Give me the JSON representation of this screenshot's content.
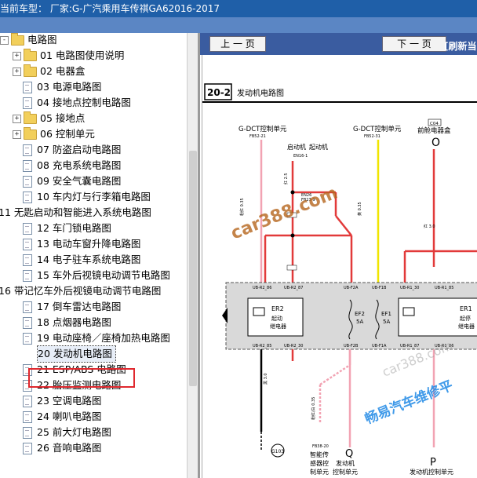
{
  "titlebar": {
    "text": "当前车型：  厂家:G-广汽乘用车传祺GA62016-2017"
  },
  "tree": {
    "items": [
      {
        "label": "电路图",
        "level": 0,
        "expander": "-",
        "icon": "folder"
      },
      {
        "label": "01 电路图使用说明",
        "level": 1,
        "expander": "+",
        "icon": "folder"
      },
      {
        "label": "02 电器盒",
        "level": 1,
        "expander": "+",
        "icon": "folder"
      },
      {
        "label": "03 电源电路图",
        "level": 1,
        "expander": "",
        "icon": "doc"
      },
      {
        "label": "04 接地点控制电路图",
        "level": 1,
        "expander": "",
        "icon": "doc"
      },
      {
        "label": "05 接地点",
        "level": 1,
        "expander": "+",
        "icon": "folder"
      },
      {
        "label": "06 控制单元",
        "level": 1,
        "expander": "+",
        "icon": "folder"
      },
      {
        "label": "07 防盗启动电路图",
        "level": 1,
        "expander": "",
        "icon": "doc"
      },
      {
        "label": "08 充电系统电路图",
        "level": 1,
        "expander": "",
        "icon": "doc"
      },
      {
        "label": "09 安全气囊电路图",
        "level": 1,
        "expander": "",
        "icon": "doc"
      },
      {
        "label": "10 车内灯与行李箱电路图",
        "level": 1,
        "expander": "",
        "icon": "doc"
      },
      {
        "label": "11 无匙启动和智能进入系统电路图",
        "level": -1,
        "expander": "",
        "icon": "none"
      },
      {
        "label": "12 车门锁电路图",
        "level": 1,
        "expander": "",
        "icon": "doc"
      },
      {
        "label": "13 电动车窗升降电路图",
        "level": 1,
        "expander": "",
        "icon": "doc"
      },
      {
        "label": "14 电子驻车系统电路图",
        "level": 1,
        "expander": "",
        "icon": "doc"
      },
      {
        "label": "15 车外后视镜电动调节电路图",
        "level": 1,
        "expander": "",
        "icon": "doc"
      },
      {
        "label": "16 带记忆车外后视镜电动调节电路图",
        "level": -1,
        "expander": "",
        "icon": "none"
      },
      {
        "label": "17 倒车雷达电路图",
        "level": 1,
        "expander": "",
        "icon": "doc"
      },
      {
        "label": "18 点烟器电路图",
        "level": 1,
        "expander": "",
        "icon": "doc"
      },
      {
        "label": "19 电动座椅／座椅加热电路图",
        "level": 1,
        "expander": "",
        "icon": "doc"
      },
      {
        "label": "20 发动机电路图",
        "level": 1,
        "expander": "",
        "icon": "doc",
        "selected": true
      },
      {
        "label": "21 ESP/ABS 电路图",
        "level": 1,
        "expander": "",
        "icon": "doc"
      },
      {
        "label": "22 胎压监测电路图",
        "level": 1,
        "expander": "",
        "icon": "doc"
      },
      {
        "label": "23 空调电路图",
        "level": 1,
        "expander": "",
        "icon": "doc"
      },
      {
        "label": "24 喇叭电路图",
        "level": 1,
        "expander": "",
        "icon": "doc"
      },
      {
        "label": "25 前大灯电路图",
        "level": 1,
        "expander": "",
        "icon": "doc"
      },
      {
        "label": "26 音响电路图",
        "level": 1,
        "expander": "",
        "icon": "doc"
      }
    ]
  },
  "viewer": {
    "prev": "上 一 页",
    "next": "下 一 页",
    "refresh": "[刷新当",
    "diagram": {
      "section_no": "20-2",
      "section_title": "发动机电路图",
      "label_dct1": "G-DCT控制单元",
      "label_dct1_pin": "FB52-21",
      "label_dct2": "G-DCT控制单元",
      "label_dct2_pin": "FB52-31",
      "label_start": "启动机",
      "label_start2": "起动机",
      "label_en": "EN16-1",
      "label_front_box": "前舱电器盒",
      "label_front_pin": "C04",
      "label_o": "O",
      "label_en26": "EN26",
      "label_fb23": "FB23-9",
      "label_er2": "ER2",
      "label_er2_name1": "起动",
      "label_er2_name2": "继电器",
      "label_ef2": "EF2",
      "label_ef2_amp": "5A",
      "label_ef1": "EF1",
      "label_ef1_amp": "5A",
      "label_er1": "ER1",
      "label_er1_name1": "起停",
      "label_er1_name2": "继电器",
      "label_ub_r2_86": "UB-R2_86",
      "label_ub_r2_87": "UB-R2_87",
      "label_ub_f2a": "UB-F2A",
      "label_ub_f1b": "UB-F1B",
      "label_ub_r1_30": "UB-R1_30",
      "label_ub_r1_85": "UB-R1_85",
      "label_ub_r2_85": "UB-R2_85",
      "label_ub_r2_30": "UB-R2_30",
      "label_ub_f2b": "UB-F2B",
      "label_ub_f1a": "UB-F1A",
      "label_ub_r1_87": "UB-R1_87",
      "label_ub_r1_86": "UB-R1_86",
      "label_g103": "G103",
      "label_fb38": "FB38-20",
      "label_smart1": "智能传",
      "label_smart2": "感器控",
      "label_smart3": "制单元",
      "label_q": "Q",
      "label_q_name1": "发动机",
      "label_q_name2": "控制单元",
      "label_p": "P",
      "label_p_name": "发动机控制单元",
      "wire_red": "红 2.5",
      "wire_red3": "红 3.0",
      "wire_black": "黑 3.0",
      "wire_yellow": "黄 0.35",
      "wire_pink": "粉红 0.35",
      "wire_pink_white": "粉红/白 0.35",
      "watermark1": "car388.com",
      "watermark2": "畅易汽车维修平",
      "watermark3": "car388.com"
    }
  }
}
